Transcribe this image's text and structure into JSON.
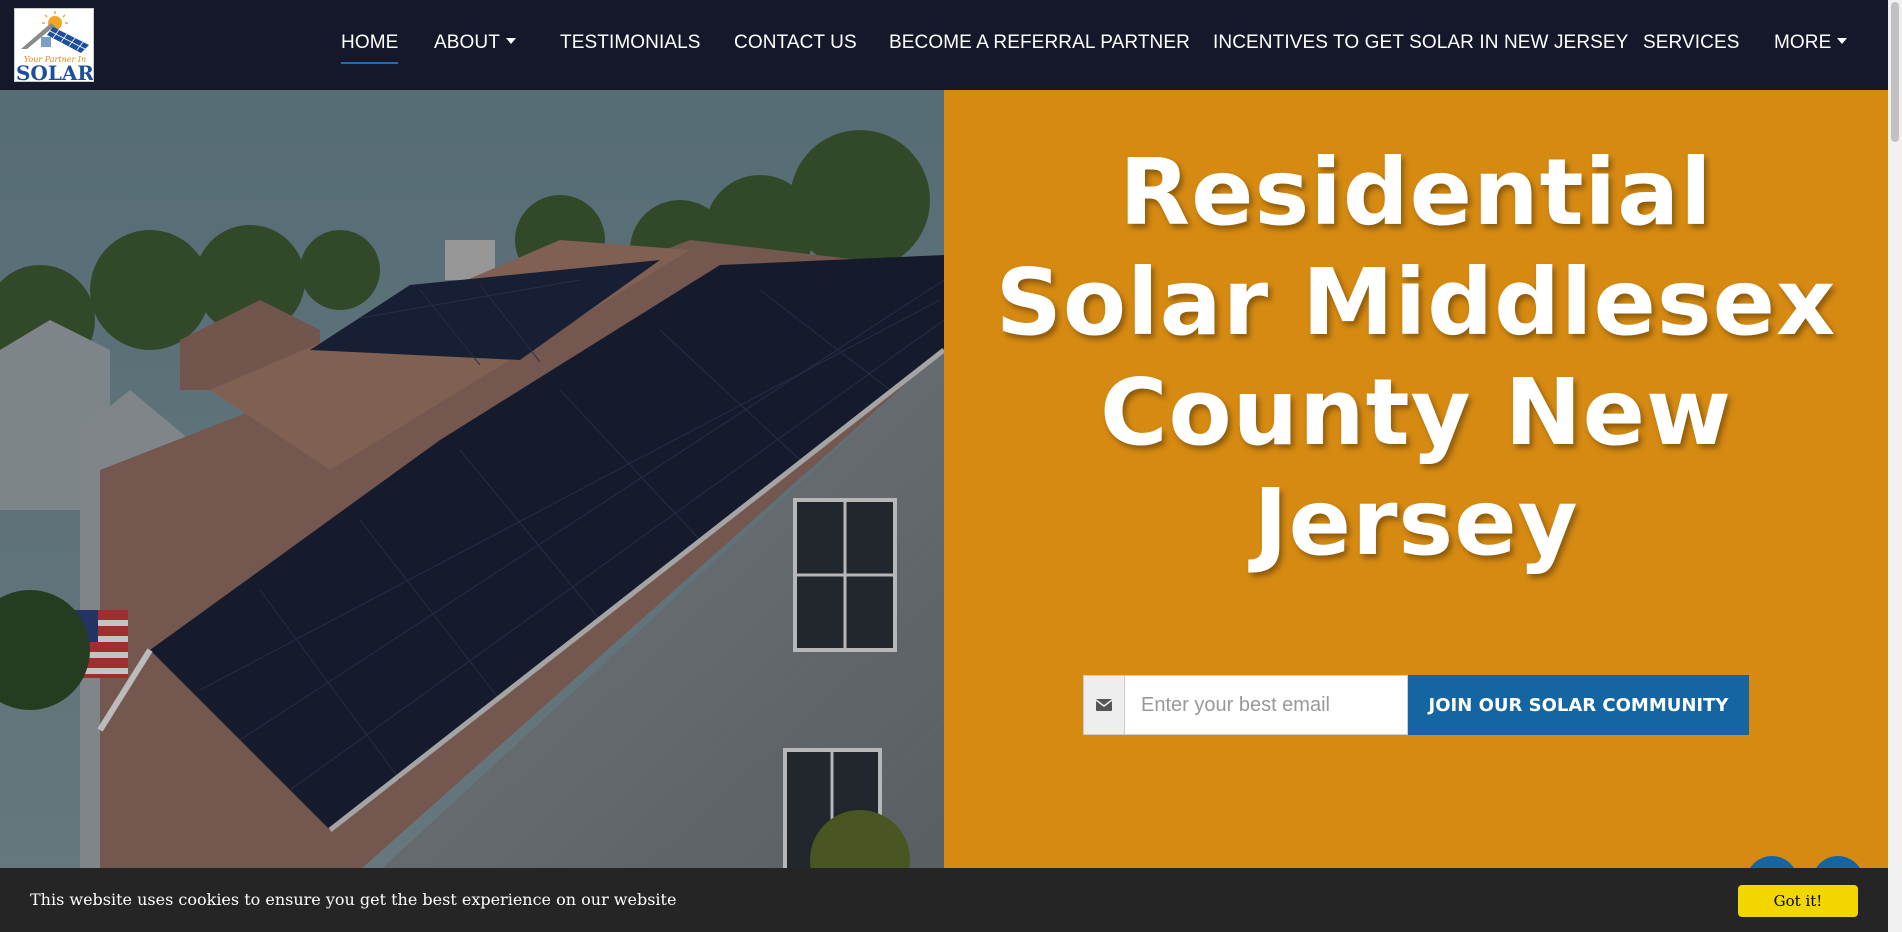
{
  "logo": {
    "tagline": "Your Partner In",
    "name": "SOLAR"
  },
  "nav": {
    "home": "HOME",
    "about": "ABOUT",
    "testimonials": "TESTIMONIALS",
    "contact": "CONTACT US",
    "referral": "BECOME A REFERRAL PARTNER",
    "incentives": "INCENTIVES TO GET SOLAR IN NEW JERSEY",
    "services": "SERVICES",
    "more": "MORE",
    "active": "HOME"
  },
  "hero": {
    "title_line1": "Residential",
    "title_line2": "Solar Middlesex",
    "title_line3": "County New",
    "title_line4": "Jersey",
    "panel_color": "#d68a12"
  },
  "signup": {
    "icon": "envelope-icon",
    "placeholder": "Enter your best email",
    "button_label": "JOIN OUR SOLAR COMMUNITY",
    "button_color": "#1565a3"
  },
  "cookie": {
    "message": "This website uses cookies to ensure you get the best experience on our website",
    "accept_label": "Got it!",
    "accept_color": "#f1d600"
  }
}
